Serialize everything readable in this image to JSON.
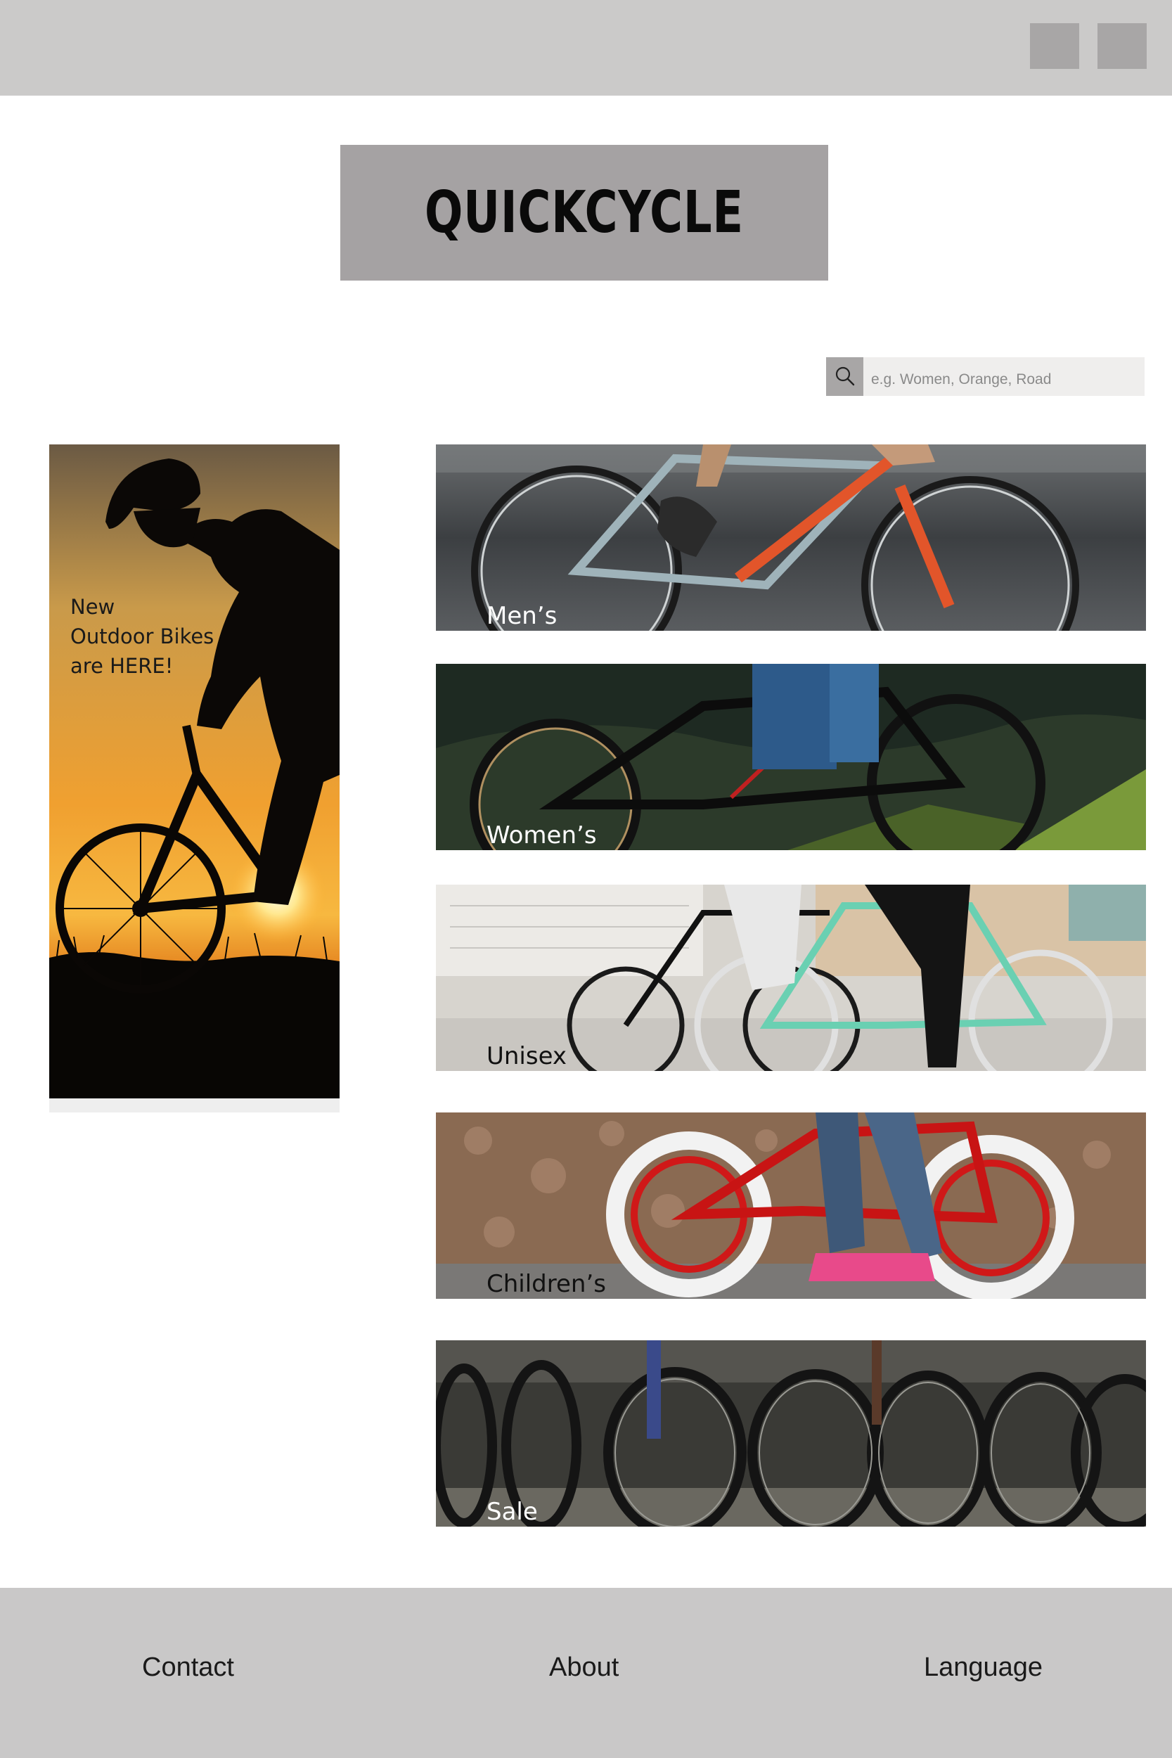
{
  "header": {
    "buttons": [
      {
        "name": "top-button-1"
      },
      {
        "name": "top-button-2"
      }
    ]
  },
  "brand": {
    "logo_text": "QUICKCYCLE"
  },
  "search": {
    "placeholder": "e.g. Women, Orange, Road",
    "icon": "search-icon"
  },
  "promo": {
    "lines": [
      "New",
      "Outdoor Bikes",
      "are HERE!"
    ]
  },
  "categories": [
    {
      "label": "Men’s"
    },
    {
      "label": "Women’s"
    },
    {
      "label": "Unisex"
    },
    {
      "label": "Children’s"
    },
    {
      "label": "Sale"
    }
  ],
  "footer": {
    "links": [
      "Contact",
      "About",
      "Language"
    ]
  },
  "colors": {
    "header_bg": "#cbcac9",
    "logo_bg": "#a5a2a3",
    "footer_bg": "#c9c8c8"
  }
}
